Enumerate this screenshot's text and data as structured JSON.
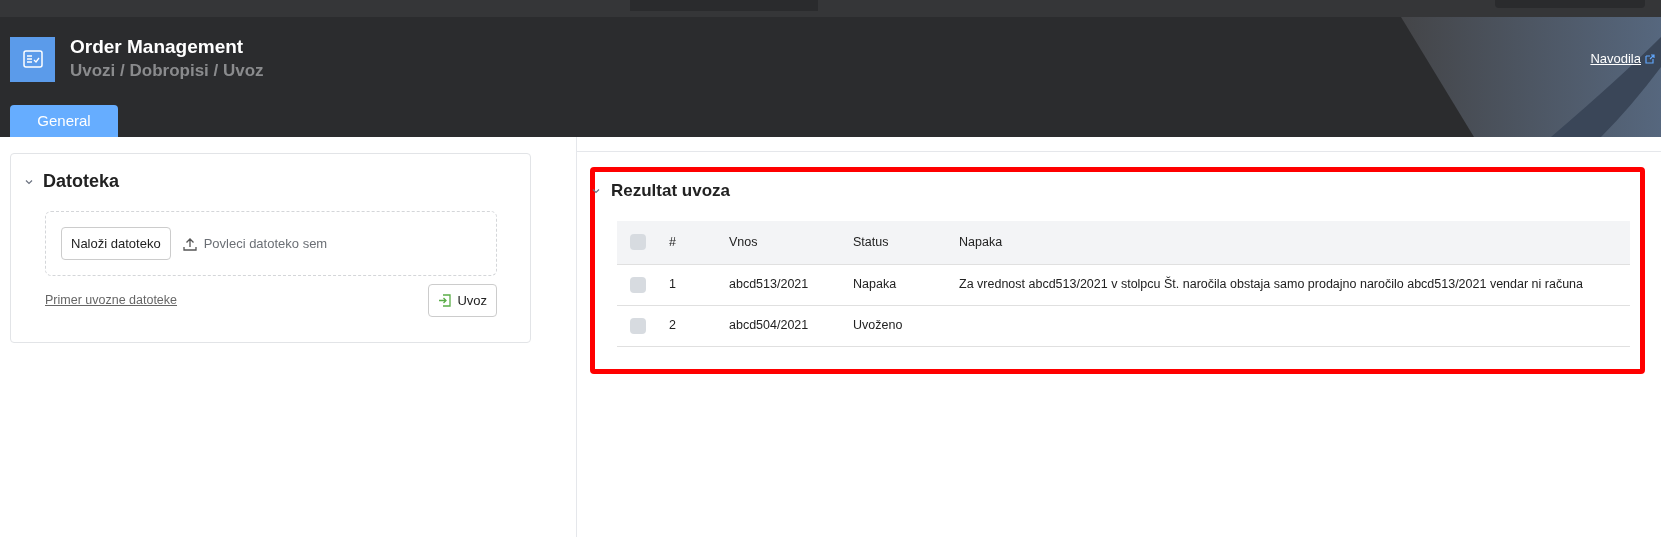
{
  "header": {
    "title": "Order Management",
    "breadcrumb": "Uvozi / Dobropisi / Uvoz",
    "help_link": "Navodila"
  },
  "tabs": [
    {
      "label": "General",
      "selected": true
    }
  ],
  "file_panel": {
    "title": "Datoteka",
    "expanded": true,
    "upload_button": "Naloži datoteko",
    "drop_hint": "Povleci datoteko sem",
    "sample_link": "Primer uvozne datoteke",
    "import_button": "Uvoz"
  },
  "result_panel": {
    "title": "Rezultat uvoza",
    "expanded": true,
    "highlighted": true,
    "table": {
      "select_all_checked": false,
      "columns": [
        "#",
        "Vnos",
        "Status",
        "Napaka"
      ],
      "rows": [
        {
          "checked": false,
          "cells": [
            "1",
            "abcd513/2021",
            "Napaka",
            "Za vrednost abcd513/2021 v stolpcu Št. naročila obstaja samo prodajno naročilo abcd513/2021 vendar ni računa"
          ]
        },
        {
          "checked": false,
          "cells": [
            "2",
            "abcd504/2021",
            "Uvoženo",
            ""
          ]
        }
      ]
    }
  }
}
